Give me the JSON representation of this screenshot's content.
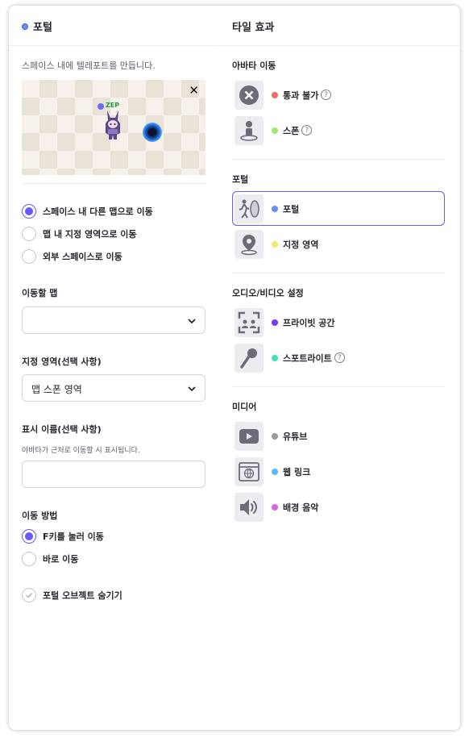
{
  "left": {
    "title": "포털",
    "description": "스페이스 내에 텔레포트를 만듭니다.",
    "preview": {
      "close_glyph": "✕",
      "player_name": "ZEP"
    },
    "destination_options": [
      {
        "label": "스페이스 내 다른 맵으로 이동",
        "selected": true
      },
      {
        "label": "맵 내 지정 영역으로 이동",
        "selected": false
      },
      {
        "label": "외부 스페이스로 이동",
        "selected": false
      }
    ],
    "target_map": {
      "label": "이동할 맵",
      "value": ""
    },
    "designated_area": {
      "label": "지정 영역(선택 사항)",
      "value": "맵 스폰 영역"
    },
    "display_name": {
      "label": "표시 이름(선택 사항)",
      "help": "아바타가 근처로 이동할 시 표시됩니다.",
      "value": ""
    },
    "move_method": {
      "label": "이동 방법",
      "options": [
        {
          "label": "F키를 눌러 이동",
          "selected": true
        },
        {
          "label": "바로 이동",
          "selected": false
        }
      ]
    },
    "hide_portal": {
      "label": "포털 오브젝트 숨기기",
      "checked": false
    }
  },
  "right": {
    "title": "타일 효과",
    "categories": [
      {
        "title": "아바타 이동",
        "tiles": [
          {
            "label": "통과 불가",
            "icon": "no-entry-icon",
            "dot_color": "#ef6b6b",
            "help": "?"
          },
          {
            "label": "스폰",
            "icon": "spawn-person-icon",
            "dot_color": "#a3ea6c",
            "help": "?"
          }
        ]
      },
      {
        "title": "포털",
        "tiles": [
          {
            "label": "포털",
            "icon": "portal-runner-icon",
            "dot_color": "#6c8cf5",
            "selected": true
          },
          {
            "label": "지정 영역",
            "icon": "map-pin-icon",
            "dot_color": "#f1e968"
          }
        ]
      },
      {
        "title": "오디오/비디오 설정",
        "tiles": [
          {
            "label": "프라이빗 공간",
            "icon": "private-space-icon",
            "dot_color": "#7c3aed"
          },
          {
            "label": "스포트라이트",
            "icon": "microphone-icon",
            "dot_color": "#3ee0b6",
            "help": "?"
          }
        ]
      },
      {
        "title": "미디어",
        "tiles": [
          {
            "label": "유튜브",
            "icon": "youtube-icon",
            "dot_color": "#9a9a9a"
          },
          {
            "label": "웹 링크",
            "icon": "web-link-icon",
            "dot_color": "#5db9f5"
          },
          {
            "label": "배경 음악",
            "icon": "speaker-icon",
            "dot_color": "#e05ee0"
          }
        ]
      }
    ]
  },
  "colors": {
    "accent": "#6758ff",
    "border": "#d5d5dc",
    "icon_bg": "#ececf1"
  }
}
